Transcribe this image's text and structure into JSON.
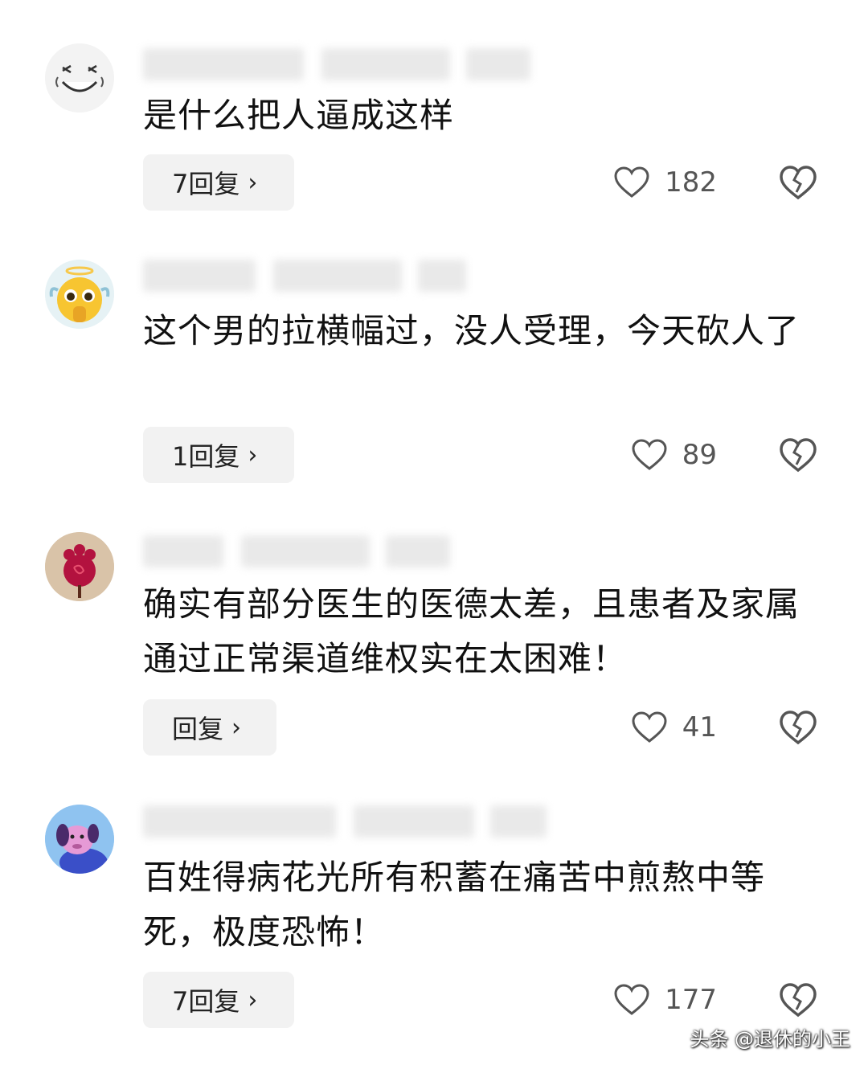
{
  "comments": [
    {
      "text": "是什么把人逼成这样",
      "reply_label": "7回复",
      "likes": "182",
      "avatar_icon": "laughing-doodle-face"
    },
    {
      "text": "这个男的拉横幅过，没人受理，今天砍人了",
      "reply_label": "1回复",
      "likes": "89",
      "avatar_icon": "angel-emoji-face"
    },
    {
      "text": "确实有部分医生的医德太差，且患者及家属通过正常渠道维权实在太困难！",
      "reply_label": "回复",
      "likes": "41",
      "avatar_icon": "red-flower-illustration"
    },
    {
      "text": "百姓得病花光所有积蓄在痛苦中煎熬中等死，极度恐怖！",
      "reply_label": "7回复",
      "likes": "177",
      "avatar_icon": "purple-cartoon-character"
    }
  ],
  "icons": {
    "like": "heart-outline-icon",
    "dislike": "broken-heart-icon",
    "chevron": "chevron-right-icon"
  },
  "watermark": "头条 @退休的小王",
  "colors": {
    "text": "#111111",
    "muted": "#555555",
    "button_bg": "#f2f2f2",
    "background": "#ffffff"
  }
}
